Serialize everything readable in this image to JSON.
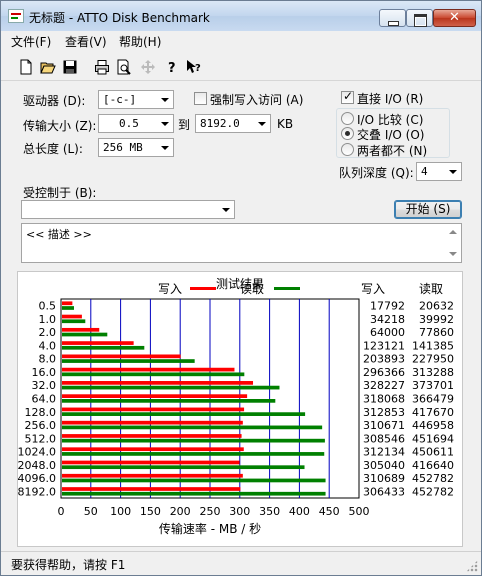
{
  "window": {
    "title": "无标题 - ATTO Disk Benchmark"
  },
  "menu": {
    "items": [
      "文件(F)",
      "查看(V)",
      "帮助(H)"
    ]
  },
  "toolbar": {
    "icons": [
      "new-icon",
      "open-icon",
      "save-icon",
      "print-icon",
      "print-preview-icon",
      "move-icon",
      "help-icon",
      "context-help-icon"
    ]
  },
  "controls": {
    "drive_label": "驱动器 (D):",
    "drive_value": "[-c-]",
    "force_write_label": "强制写入访问 (A)",
    "force_write_checked": false,
    "direct_io_label": "直接 I/O (R)",
    "direct_io_checked": true,
    "transfer_label": "传输大小 (Z):",
    "transfer_from": "0.5",
    "to_label": "到",
    "transfer_to": "8192.0",
    "kb_label": "KB",
    "total_length_label": "总长度 (L):",
    "total_length_value": "256 MB",
    "io_compare_label": "I/O 比较 (C)",
    "overlap_io_label": "交叠 I/O (O)",
    "neither_label": "两者都不 (N)",
    "selected_mode": "overlap_io",
    "queue_depth_label": "队列深度 (Q):",
    "queue_depth_value": "4",
    "controlled_by_label": "受控制于 (B):",
    "controlled_by_value": "",
    "start_button": "开始 (S)",
    "description_text": "<< 描述 >>"
  },
  "chart_data": {
    "type": "bar",
    "title": "测试结果",
    "legend": {
      "write": "写入",
      "read": "读取",
      "placement": "top"
    },
    "xlabel": "传输速率 - MB / 秒",
    "xlim": [
      0,
      500
    ],
    "xticks": [
      "0",
      "50",
      "100",
      "150",
      "200",
      "250",
      "300",
      "350",
      "400",
      "450",
      "500"
    ],
    "categories": [
      "0.5",
      "1.0",
      "2.0",
      "4.0",
      "8.0",
      "16.0",
      "32.0",
      "64.0",
      "128.0",
      "256.0",
      "512.0",
      "1024.0",
      "2048.0",
      "4096.0",
      "8192.0"
    ],
    "series": [
      {
        "name": "写入",
        "color": "#ff0000",
        "values": [
          17.4,
          33.4,
          62.5,
          120.2,
          199.1,
          289.4,
          320.5,
          310.6,
          305.5,
          303.4,
          301.3,
          305.0,
          297.9,
          303.4,
          299.3
        ]
      },
      {
        "name": "读取",
        "color": "#008000",
        "values": [
          20.1,
          39.1,
          76.0,
          138.1,
          222.6,
          305.9,
          364.9,
          357.9,
          407.9,
          436.5,
          441.1,
          440.0,
          406.9,
          442.2,
          442.2
        ]
      }
    ],
    "table_headers": {
      "write": "写入",
      "read": "读取"
    },
    "table_write": [
      "17792",
      "34218",
      "64000",
      "123121",
      "203893",
      "296366",
      "328227",
      "318068",
      "312853",
      "310671",
      "308546",
      "312134",
      "305040",
      "310689",
      "306433"
    ],
    "table_read": [
      "20632",
      "39992",
      "77860",
      "141385",
      "227950",
      "313288",
      "373701",
      "366479",
      "417670",
      "446958",
      "451694",
      "450611",
      "416640",
      "452782",
      "452782"
    ],
    "grid": true,
    "grid_color": "#0000c0"
  },
  "status": {
    "text": "要获得帮助，请按 F1"
  }
}
